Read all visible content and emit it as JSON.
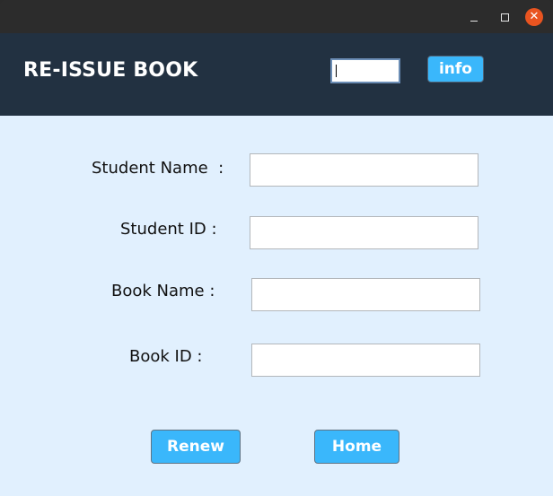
{
  "window": {
    "controls": {
      "minimize": "minimize-icon",
      "maximize": "maximize-icon",
      "close": "close-icon",
      "close_glyph": "✕"
    }
  },
  "header": {
    "title": "RE-ISSUE BOOK",
    "search_value": "",
    "info_label": "info",
    "background": "#223141"
  },
  "form": {
    "fields": [
      {
        "label": "Student Name  :",
        "value": ""
      },
      {
        "label": "Student ID :",
        "value": ""
      },
      {
        "label": "Book Name :",
        "value": ""
      },
      {
        "label": "Book ID :",
        "value": ""
      }
    ]
  },
  "actions": {
    "renew_label": "Renew",
    "home_label": "Home",
    "accent": "#3ab7fb"
  }
}
